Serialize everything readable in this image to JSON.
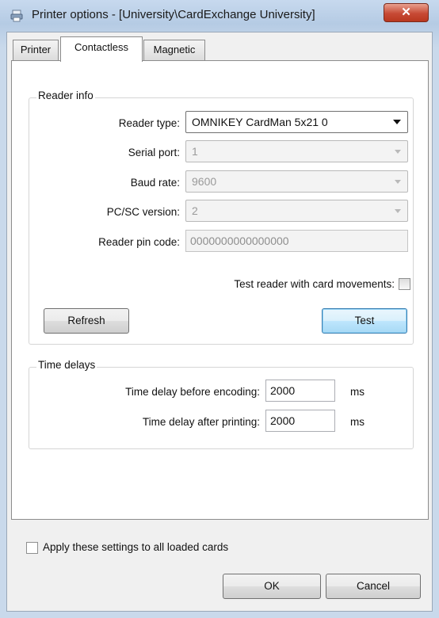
{
  "window": {
    "title": "Printer options - [University\\CardExchange University]",
    "close_label": "✕"
  },
  "tabs": [
    {
      "label": "Printer",
      "active": false
    },
    {
      "label": "Contactless",
      "active": true
    },
    {
      "label": "Magnetic",
      "active": false
    }
  ],
  "reader_info": {
    "group_title": "Reader info",
    "reader_type": {
      "label": "Reader type:",
      "value": "OMNIKEY CardMan 5x21 0"
    },
    "serial_port": {
      "label": "Serial port:",
      "value": "1"
    },
    "baud_rate": {
      "label": "Baud rate:",
      "value": "9600"
    },
    "pcsc_version": {
      "label": "PC/SC version:",
      "value": "2"
    },
    "reader_pin_code": {
      "label": "Reader pin code:",
      "value": "0000000000000000"
    },
    "test_with_card_movements": {
      "label": "Test reader with card movements:",
      "checked": false
    },
    "refresh_button": "Refresh",
    "test_button": "Test"
  },
  "time_delays": {
    "group_title": "Time delays",
    "before_encoding": {
      "label": "Time delay before encoding:",
      "value": "2000",
      "unit": "ms"
    },
    "after_printing": {
      "label": "Time delay after printing:",
      "value": "2000",
      "unit": "ms"
    }
  },
  "footer": {
    "apply_all": {
      "label": "Apply these settings to all loaded cards",
      "checked": false
    },
    "ok_button": "OK",
    "cancel_button": "Cancel"
  },
  "colors": {
    "title_bar": "#b5cbe4",
    "close_button": "#c74a35",
    "default_button": "#bee6fd"
  }
}
